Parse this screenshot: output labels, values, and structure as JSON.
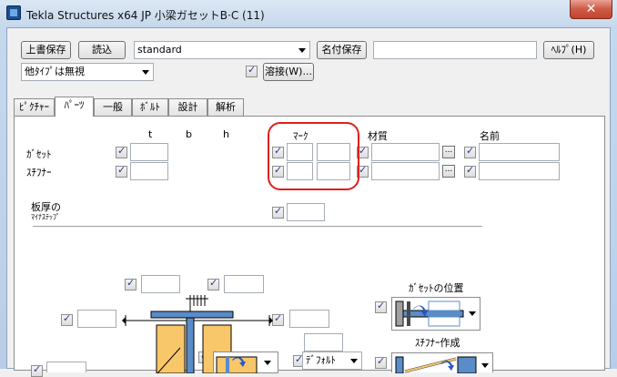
{
  "window": {
    "title": "Tekla Structures x64  JP 小梁ガセットB·C (11)",
    "close": "✕"
  },
  "toolbar": {
    "overwrite_save": "上書保存",
    "load": "読込",
    "preset": "standard",
    "save_as": "名付保存",
    "save_as_name": "",
    "help": "ﾍﾙﾌﾟ(H)",
    "other_types": "他ﾀｲﾌﾟは無視",
    "weld": "溶接(W)..."
  },
  "tabs": [
    "ﾋﾟｸﾁｬｰ",
    "ﾊﾟｰﾂ",
    "一般",
    "ﾎﾞﾙﾄ",
    "設計",
    "解析"
  ],
  "parts": {
    "col_t": "t",
    "col_b": "b",
    "col_h": "h",
    "col_mark": "ﾏｰｸ",
    "col_material": "材質",
    "col_name": "名前",
    "row_gusset": "ｶﾞｾｯﾄ",
    "row_stiffener": "ｽﾁﾌﾅｰ",
    "plate_thickness": "板厚の",
    "plate_thickness_line2": "ﾏｲﾅｽﾃｯﾌﾟ",
    "browse": "..."
  },
  "picture": {
    "gusset_position": "ｶﾞｾｯﾄの位置",
    "stiffener_create": "ｽﾁﾌﾅｰ作成",
    "default": "ﾃﾞﾌｫﾙﾄ"
  },
  "colors": {
    "accent_red": "#e0201a",
    "plate_orange": "#f7c76a",
    "beam_blue": "#5b8cc8"
  }
}
